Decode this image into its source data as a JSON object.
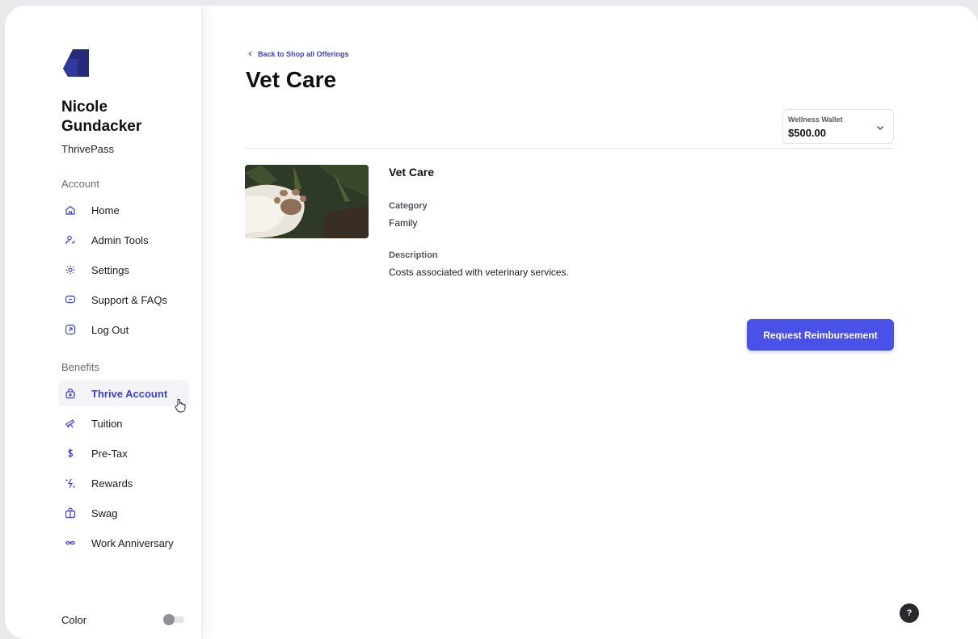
{
  "sidebar": {
    "user_name": "Nicole Gundacker",
    "user_org": "ThrivePass",
    "account_label": "Account",
    "account_items": [
      {
        "label": "Home",
        "icon": "home-icon"
      },
      {
        "label": "Admin Tools",
        "icon": "admin-user-icon"
      },
      {
        "label": "Settings",
        "icon": "gear-icon"
      },
      {
        "label": "Support & FAQs",
        "icon": "chat-bubble-icon"
      },
      {
        "label": "Log Out",
        "icon": "logout-icon"
      }
    ],
    "benefits_label": "Benefits",
    "benefit_items": [
      {
        "label": "Thrive Account",
        "icon": "wallet-lock-icon",
        "active": true
      },
      {
        "label": "Tuition",
        "icon": "telescope-icon"
      },
      {
        "label": "Pre-Tax",
        "icon": "dollar-icon"
      },
      {
        "label": "Rewards",
        "icon": "sparkle-bolt-icon"
      },
      {
        "label": "Swag",
        "icon": "bag-icon"
      },
      {
        "label": "Work Anniversary",
        "icon": "infinity-icon"
      }
    ],
    "color_label": "Color",
    "color_toggle_on": false
  },
  "main": {
    "back_link": "Back to Shop all Offerings",
    "title": "Vet Care",
    "wallet": {
      "label": "Wellness Wallet",
      "amount": "$500.00"
    },
    "detail": {
      "title": "Vet Care",
      "category_label": "Category",
      "category_value": "Family",
      "description_label": "Description",
      "description_value": "Costs associated with veterinary services."
    },
    "cta_label": "Request Reimbursement",
    "help_label": "?"
  },
  "colors": {
    "accent": "#4a51e8",
    "active_nav_text": "#3b42d6",
    "logo": "#262a7a"
  }
}
